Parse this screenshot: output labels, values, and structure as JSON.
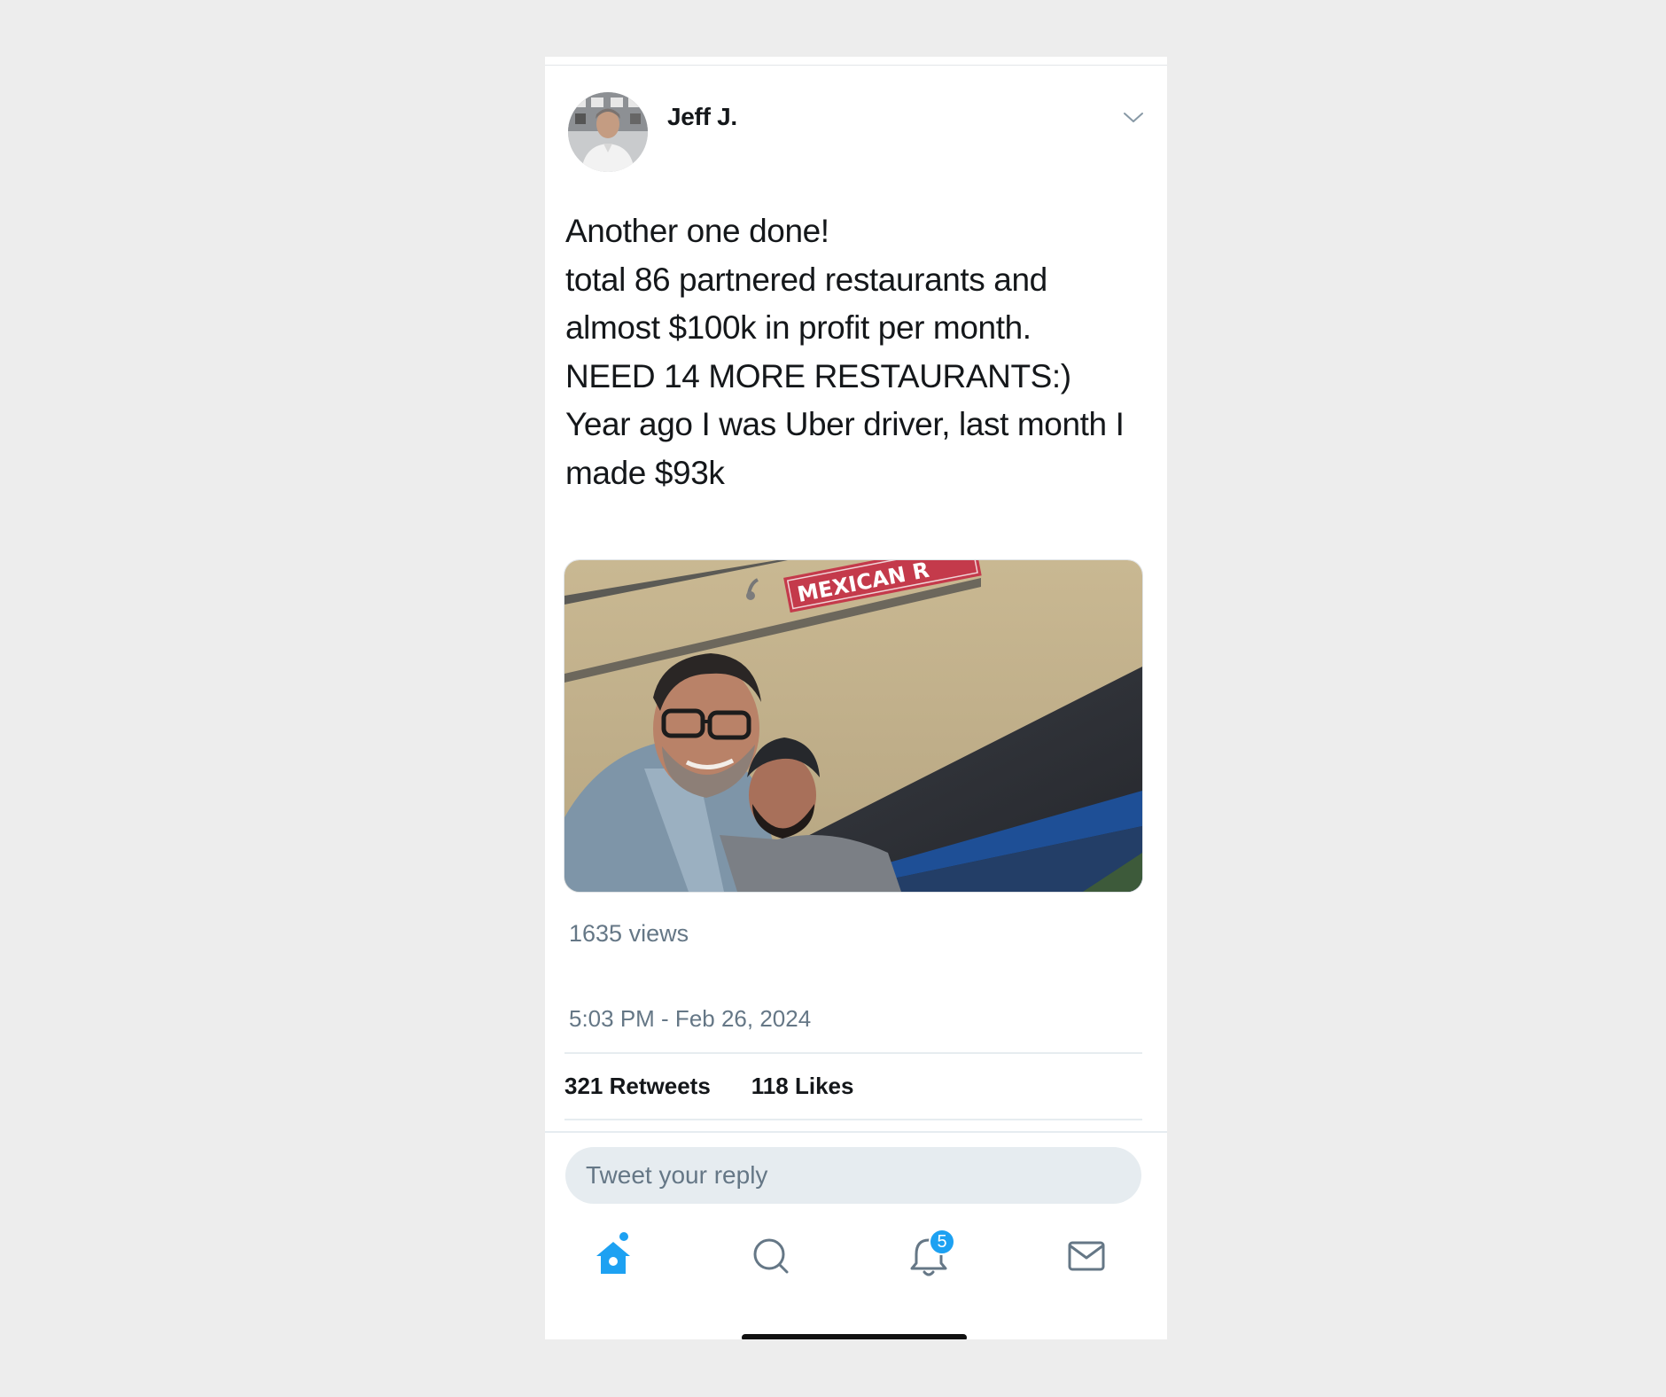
{
  "tweet": {
    "author_name": "Jeff J.",
    "text": "Another one done!\ntotal 86 partnered restaurants and almost $100k in profit per month.\nNEED 14 MORE RESTAURANTS:)\nYear ago I was Uber driver, last month I made $93k",
    "media": {
      "sign_text": "MEXICAN R"
    },
    "views": "1635 views",
    "timestamp": "5:03 PM - Feb 26, 2024",
    "retweets_count": "321",
    "retweets_label": "Retweets",
    "likes_count": "118",
    "likes_label": "Likes"
  },
  "reply": {
    "placeholder": "Tweet your reply"
  },
  "tabbar": {
    "notifications_badge": "5",
    "items": [
      "home-icon",
      "search-icon",
      "bell-icon",
      "mail-icon"
    ]
  },
  "colors": {
    "accent": "#1da1f2",
    "secondary_text": "#657786",
    "primary_text": "#14171a"
  }
}
